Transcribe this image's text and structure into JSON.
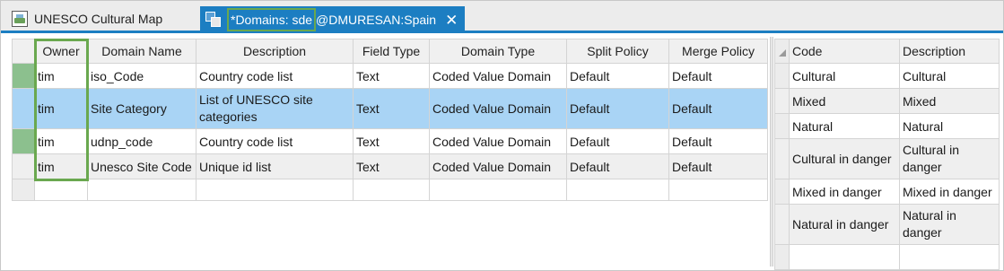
{
  "tabs": [
    {
      "label": "UNESCO Cultural Map"
    },
    {
      "label_boxed": "*Domains: sde",
      "label_rest": "@DMURESAN:Spain"
    }
  ],
  "domains_table": {
    "columns": [
      "Owner",
      "Domain Name",
      "Description",
      "Field Type",
      "Domain Type",
      "Split Policy",
      "Merge Policy"
    ],
    "rows": [
      {
        "owner": "tim",
        "domain_name": "iso_Code",
        "description": "Country code list",
        "field_type": "Text",
        "domain_type": "Coded Value Domain",
        "split_policy": "Default",
        "merge_policy": "Default"
      },
      {
        "owner": "tim",
        "domain_name": "Site Category",
        "description": "List of UNESCO site categories",
        "field_type": "Text",
        "domain_type": "Coded Value Domain",
        "split_policy": "Default",
        "merge_policy": "Default"
      },
      {
        "owner": "tim",
        "domain_name": "udnp_code",
        "description": "Country code list",
        "field_type": "Text",
        "domain_type": "Coded Value Domain",
        "split_policy": "Default",
        "merge_policy": "Default"
      },
      {
        "owner": "tim",
        "domain_name": "Unesco Site Code",
        "description": "Unique id list",
        "field_type": "Text",
        "domain_type": "Coded Value Domain",
        "split_policy": "Default",
        "merge_policy": "Default"
      }
    ]
  },
  "codes_table": {
    "columns": [
      "Code",
      "Description"
    ],
    "rows": [
      {
        "code": "Cultural",
        "description": "Cultural"
      },
      {
        "code": "Mixed",
        "description": "Mixed"
      },
      {
        "code": "Natural",
        "description": "Natural"
      },
      {
        "code": "Cultural in danger",
        "description": "Cultural in danger"
      },
      {
        "code": "Mixed in danger",
        "description": "Mixed in danger"
      },
      {
        "code": "Natural in danger",
        "description": "Natural in danger"
      }
    ]
  },
  "colors": {
    "accent": "#1c7ec2",
    "selected_row": "#a9d4f5",
    "highlight_box": "#6aa84f"
  }
}
